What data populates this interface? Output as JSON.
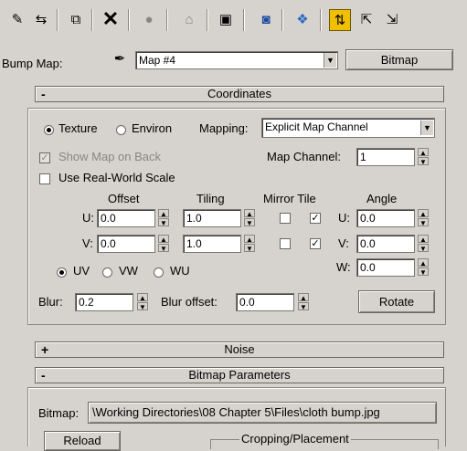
{
  "toolbar": {
    "icons": [
      "pick-material-icon",
      "material-put-icon",
      "assign-material-icon",
      "delete-icon",
      "unique-icon",
      "material-effects-icon",
      "map-navigator-icon",
      "show-map-icon",
      "background-icon",
      "show-end-result-icon",
      "go-to-parent-icon",
      "go-forward-icon"
    ],
    "active_icon": "show-end-result-icon"
  },
  "bump": {
    "label": "Bump Map:",
    "map_value": "Map #4",
    "type_button": "Bitmap"
  },
  "coordinates": {
    "sign": "-",
    "title": "Coordinates",
    "texture_label": "Texture",
    "environ_label": "Environ",
    "mapping_label": "Mapping:",
    "mapping_value": "Explicit Map Channel",
    "show_map_on_back": "Show Map on Back",
    "map_channel_label": "Map Channel:",
    "map_channel_value": "1",
    "use_real_world": "Use Real-World Scale",
    "offset_header": "Offset",
    "tiling_header": "Tiling",
    "mirror_tile_header": "Mirror Tile",
    "angle_header": "Angle",
    "u_label": "U:",
    "v_label": "V:",
    "w_label": "W:",
    "u_offset": "0.0",
    "v_offset": "0.0",
    "u_tiling": "1.0",
    "v_tiling": "1.0",
    "u_angle": "0.0",
    "v_angle": "0.0",
    "w_angle": "0.0",
    "uv_label": "UV",
    "vw_label": "VW",
    "wu_label": "WU",
    "blur_label": "Blur:",
    "blur_value": "0.2",
    "blur_offset_label": "Blur offset:",
    "blur_offset_value": "0.0",
    "rotate_button": "Rotate"
  },
  "noise": {
    "sign": "+",
    "title": "Noise"
  },
  "bitmap_params": {
    "sign": "-",
    "title": "Bitmap Parameters",
    "bitmap_label": "Bitmap:",
    "bitmap_path": "\\Working Directories\\08 Chapter 5\\Files\\cloth bump.jpg",
    "reload_button": "Reload",
    "cropping_label": "Cropping/Placement"
  }
}
